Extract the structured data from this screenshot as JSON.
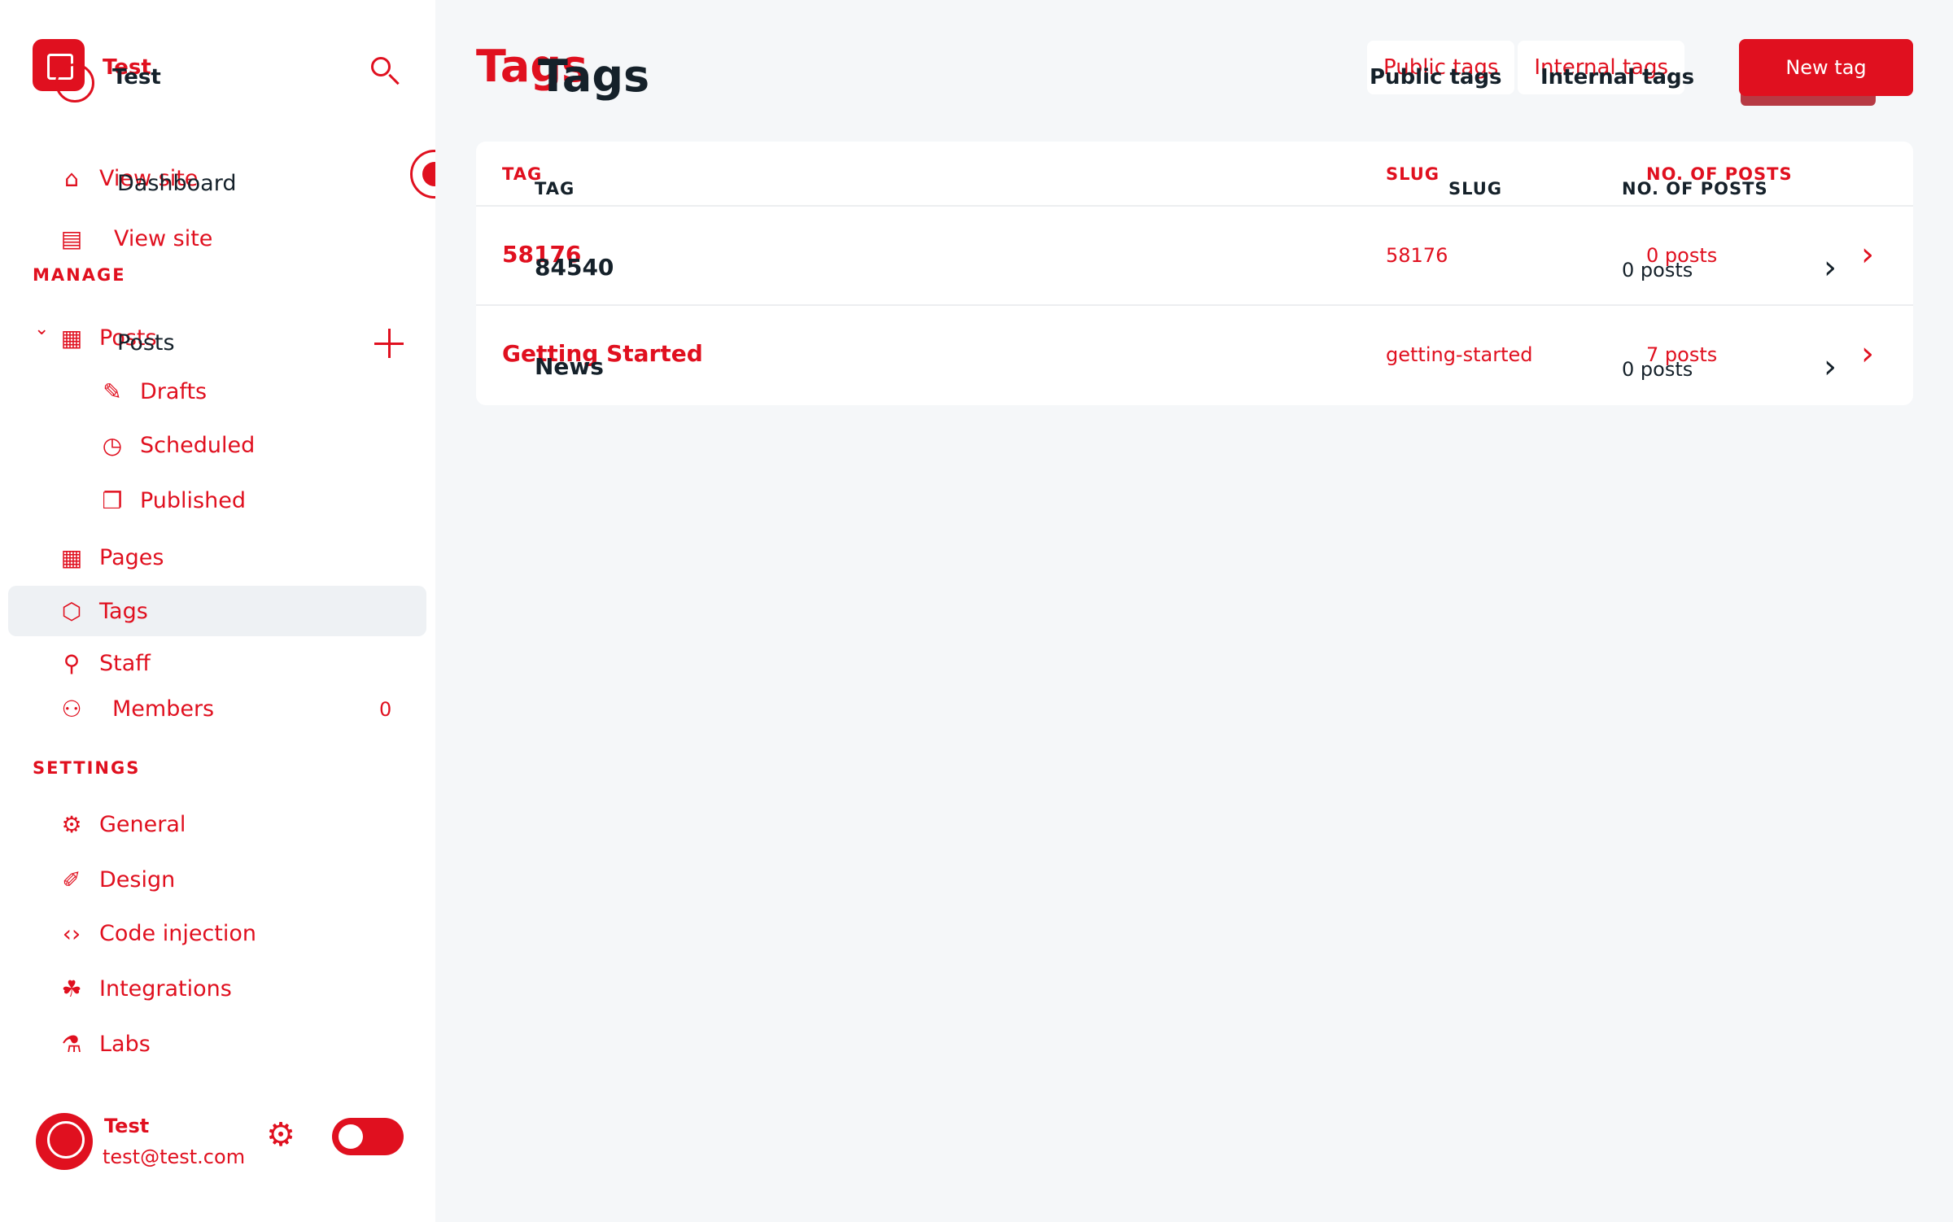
{
  "brand": {
    "name": "Test"
  },
  "nav": {
    "view_site_a": "View site",
    "dashboard": "Dashboard",
    "view_site": "View site",
    "manage_title": "MANAGE",
    "posts": "Posts",
    "drafts": "Drafts",
    "scheduled": "Scheduled",
    "published": "Published",
    "pages": "Pages",
    "tags": "Tags",
    "staff": "Staff",
    "members": "Members",
    "members_count": "0",
    "settings_title": "SETTINGS",
    "general": "General",
    "design": "Design",
    "code_injection": "Code injection",
    "integrations": "Integrations",
    "labs": "Labs"
  },
  "user": {
    "name": "Test",
    "email": "test@test.com"
  },
  "page": {
    "title": "Tags"
  },
  "tabs": {
    "public": "Public tags",
    "internal": "Internal tags"
  },
  "new_tag_label": "New tag",
  "table": {
    "headers": {
      "tag": "TAG",
      "slug": "SLUG",
      "posts": "NO. OF POSTS"
    },
    "rows": [
      {
        "name": "58176",
        "ghost_name": "84540",
        "slug": "58176",
        "posts": "0 posts",
        "ghost_posts": "0 posts"
      },
      {
        "name": "Getting Started",
        "ghost_name": "News",
        "slug": "getting-started",
        "posts": "7 posts",
        "ghost_posts": "0 posts"
      }
    ]
  },
  "colors": {
    "accent": "#e0101f",
    "text": "#15212a",
    "background": "#f5f7f9"
  }
}
